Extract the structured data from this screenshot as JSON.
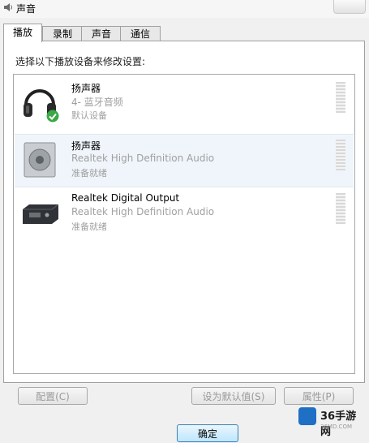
{
  "window": {
    "title": "声音"
  },
  "tabs": [
    {
      "label": "播放",
      "active": true
    },
    {
      "label": "录制"
    },
    {
      "label": "声音"
    },
    {
      "label": "通信"
    }
  ],
  "instruction": "选择以下播放设备来修改设置:",
  "devices": [
    {
      "name": "扬声器",
      "sub": "4- 蓝牙音频",
      "status": "默认设备",
      "icon": "headphones-icon",
      "default": true
    },
    {
      "name": "扬声器",
      "sub": "Realtek High Definition Audio",
      "status": "准备就绪",
      "icon": "speaker-icon",
      "selected": true
    },
    {
      "name": "Realtek Digital Output",
      "sub": "Realtek High Definition Audio",
      "status": "准备就绪",
      "icon": "digital-output-icon"
    }
  ],
  "buttons": {
    "configure": "配置(C)",
    "set_default": "设为默认值(S)",
    "properties": "属性(P)",
    "ok": "确定"
  },
  "watermark": {
    "name": "36手游网",
    "url": "36MD.COM"
  },
  "colors": {
    "check": "#3aa845",
    "accent": "#3c7fb1"
  }
}
